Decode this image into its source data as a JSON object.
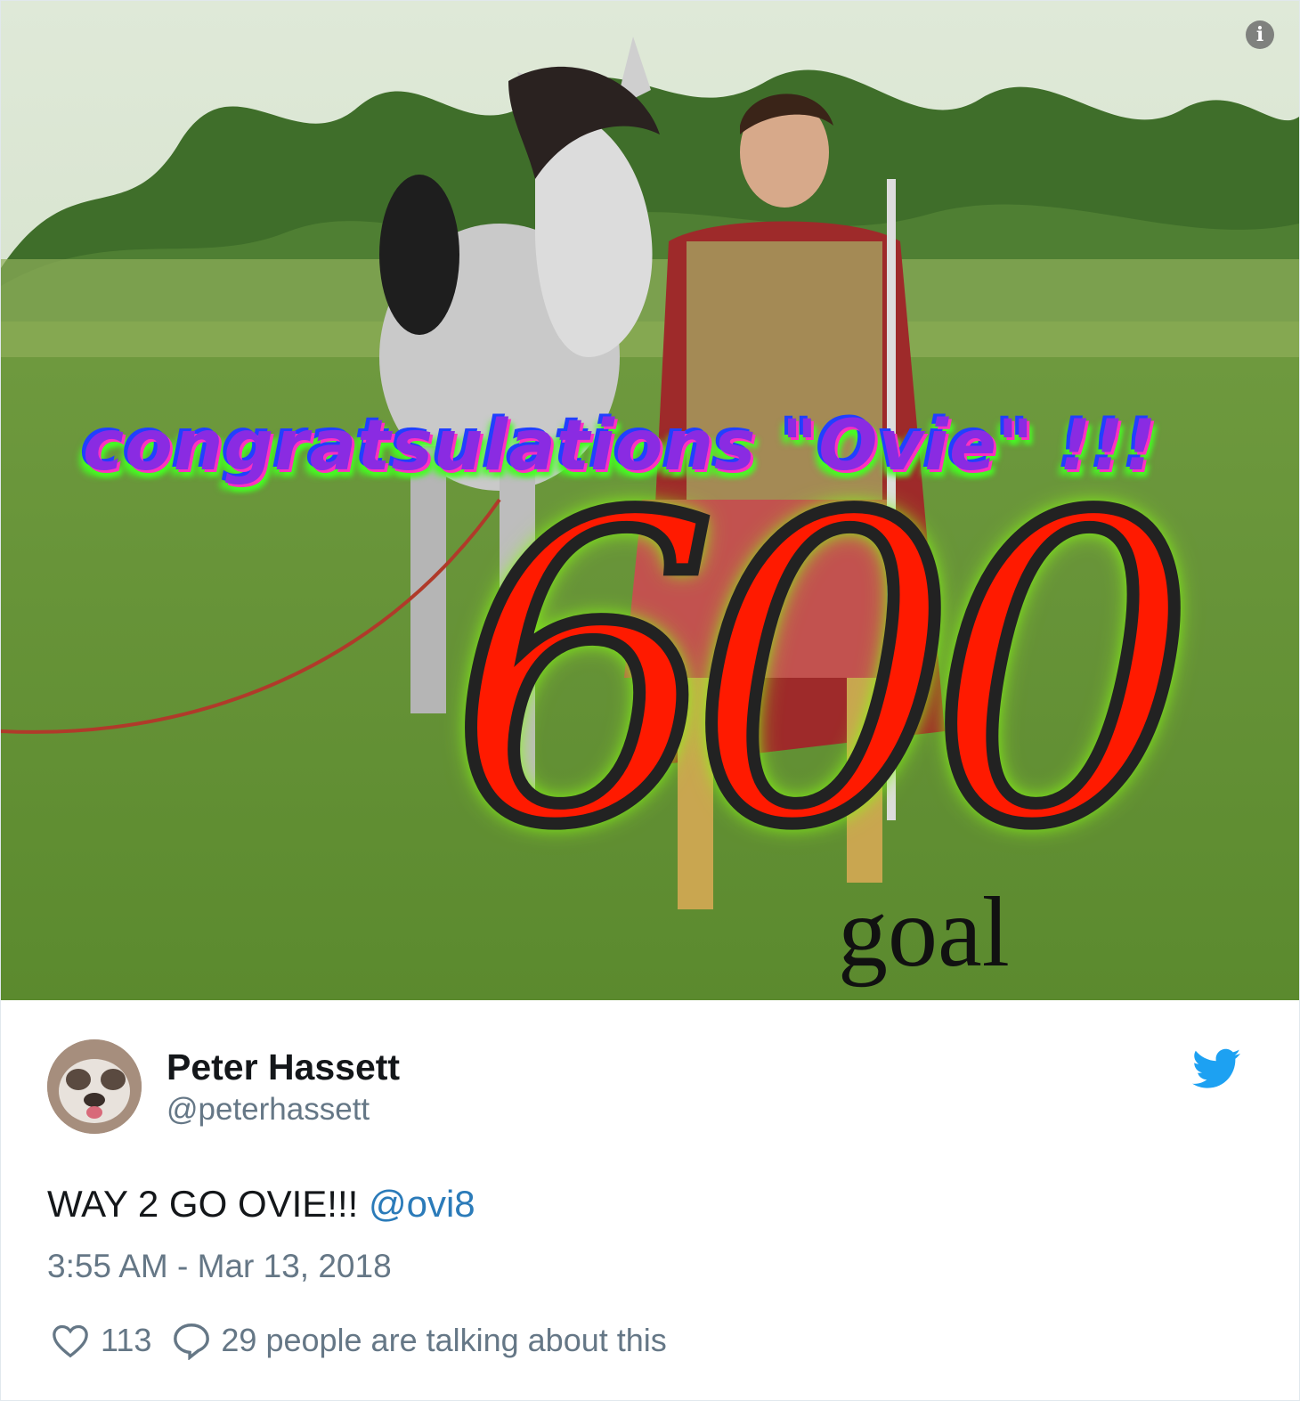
{
  "media": {
    "overlay_text": "congratsulations \"Ovie\" !!!",
    "overlay_number": "600",
    "overlay_caption": "goal"
  },
  "author": {
    "name": "Peter Hassett",
    "handle": "@peterhassett"
  },
  "tweet": {
    "text": "WAY 2 GO OVIE!!! ",
    "mention": "@ovi8",
    "timestamp": "3:55 AM - Mar 13, 2018"
  },
  "actions": {
    "likes": "113",
    "talking": "29 people are talking about this"
  },
  "colors": {
    "twitter_blue": "#1da1f2",
    "link_blue": "#2b7bb9",
    "muted_text": "#657786"
  },
  "icons": [
    "info-icon",
    "twitter-bird-icon",
    "heart-icon",
    "comment-icon"
  ]
}
